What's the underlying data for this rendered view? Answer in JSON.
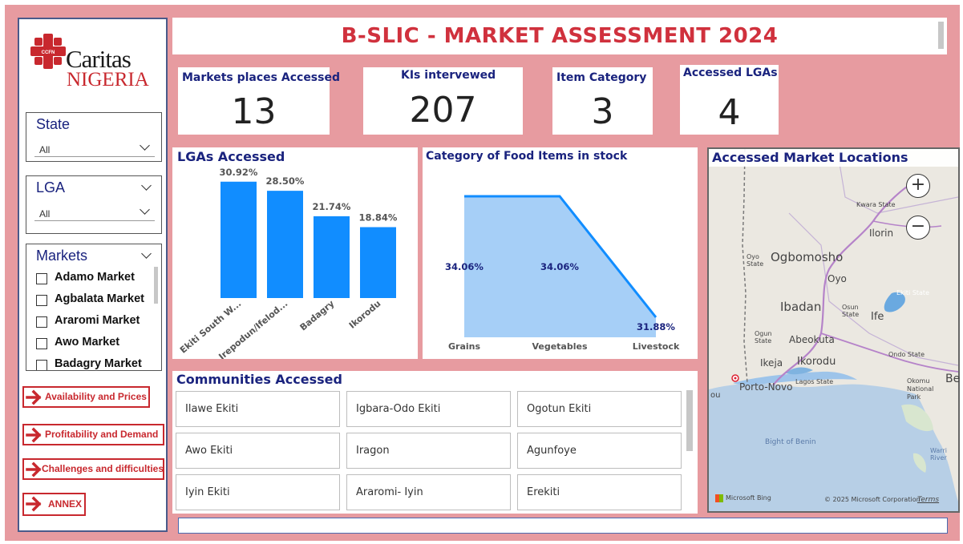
{
  "header": {
    "title": "B-SLIC - MARKET ASSESSMENT 2024"
  },
  "logo": {
    "line1": "Caritas",
    "line2": "NIGERIA",
    "emblem": "cross-emblem-icon"
  },
  "filters": {
    "state": {
      "title": "State",
      "value": "All"
    },
    "lga": {
      "title": "LGA",
      "value": "All"
    },
    "markets": {
      "title": "Markets",
      "items": [
        "Adamo Market",
        "Agbalata Market",
        "Araromi Market",
        "Awo Market",
        "Badagry Market"
      ]
    }
  },
  "nav": [
    "Availability and Prices",
    "Profitability and Demand",
    "Challenges and difficulties",
    "ANNEX"
  ],
  "kpis": {
    "markets": {
      "label": "Markets places Accessed",
      "value": "13"
    },
    "kis": {
      "label": "KIs intervewed",
      "value": "207"
    },
    "category": {
      "label": "Item Category",
      "value": "3"
    },
    "lgas": {
      "label": "Accessed LGAs",
      "value": "4"
    }
  },
  "lga_chart_title": "LGAs Accessed",
  "food_chart_title": "Category of Food Items in stock",
  "communities": {
    "title": "Communities Accessed",
    "cells": [
      "Ilawe Ekiti",
      "Igbara-Odo Ekiti",
      "Ogotun Ekiti",
      "Awo Ekiti",
      "Iragon",
      "Agunfoye",
      "Iyin Ekiti",
      "Araromi- Iyin",
      "Erekiti"
    ]
  },
  "map": {
    "title": "Accessed Market Locations",
    "labels": [
      "Kwara State",
      "Ilorin",
      "Oyo State",
      "Ogbomosho",
      "Oyo",
      "Ekiti State",
      "Ibadan",
      "Osun State",
      "Ife",
      "Ogun State",
      "Abeokuta",
      "Ondo State",
      "Ikeja",
      "Ikorodu",
      "Porto-Novo",
      "Lagos State",
      "Okomu National Park",
      "Bight of Benin",
      "Warri River",
      "Be",
      "ou"
    ],
    "attribution": "© 2025 Microsoft Corporation",
    "terms": "Terms",
    "brand": "Microsoft Bing",
    "zoom_in": "+",
    "zoom_out": "−"
  },
  "colors": {
    "accent_red": "#d0313d",
    "navy": "#1a237e",
    "bar_blue": "#118dff",
    "area_fill": "#a6cff7",
    "bg_pink": "#e79ba0"
  },
  "chart_data": [
    {
      "type": "bar",
      "title": "LGAs Accessed",
      "categories": [
        "Ekiti South W...",
        "Irepodun/Ifelod...",
        "Badagry",
        "Ikorodu"
      ],
      "values": [
        30.92,
        28.5,
        21.74,
        18.84
      ],
      "value_labels": [
        "30.92%",
        "28.50%",
        "21.74%",
        "18.84%"
      ],
      "ylim": [
        0,
        33
      ],
      "grid": false
    },
    {
      "type": "area",
      "title": "Category of Food Items in stock",
      "categories": [
        "Grains",
        "Vegetables",
        "Livestock"
      ],
      "values": [
        34.06,
        34.06,
        31.88
      ],
      "value_labels": [
        "34.06%",
        "34.06%",
        "31.88%"
      ],
      "ylim": [
        31.88,
        34.06
      ],
      "grid": false
    }
  ]
}
